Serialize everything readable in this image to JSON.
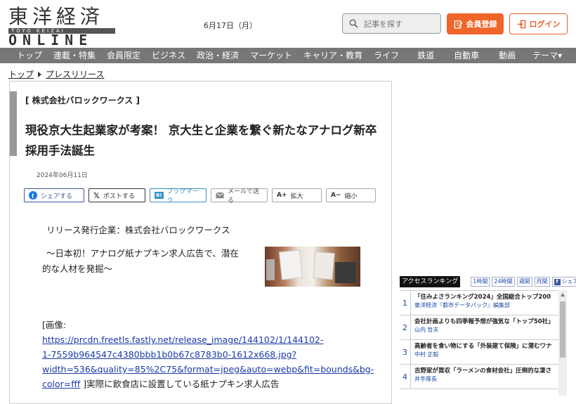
{
  "header": {
    "logo_main": "東洋経済",
    "logo_sub": "TOYO KEIZAI",
    "logo_bottom": "ONLINE",
    "date": "6月17日（月）",
    "search_placeholder": "記事を探す",
    "register_label": "会員登録",
    "login_label": "ログイン"
  },
  "nav": {
    "items": [
      "トップ",
      "連載・特集",
      "会員限定",
      "ビジネス",
      "政治・経済",
      "マーケット",
      "キャリア・教育",
      "ライフ",
      "鉄道",
      "自動車",
      "動画",
      "テーマ▾"
    ]
  },
  "breadcrumb": {
    "top": "トップ",
    "current": "プレスリリース"
  },
  "article": {
    "company_tag": "[ 株式会社バロックワークス ]",
    "headline": "現役京大生起業家が考案！ 京大生と企業を繋ぐ新たなアナログ新卒採用手法誕生",
    "date": "2024年06月11日",
    "share_buttons": {
      "facebook": "シェアする",
      "x": "ポストする",
      "bookmark": "ブックマーク",
      "mail": "メールで送る",
      "zoom_in": "拡大",
      "zoom_out": "縮小"
    },
    "release_company": "リリース発行企業：株式会社バロックワークス",
    "subtitle_line1": "～日本初！アナログ紙ナプキン求人広告で、潜在",
    "subtitle_line2": "的な人材を発掘～",
    "image_label": "[画像:",
    "image_url_lines": [
      "https://prcdn.freetls.fastly.net/release_image/144102/1/144102-",
      "1-7559b964547c4380bbb1b0b67c8783b0-1612x668.jpg?",
      "width=536&quality=85%2C75&format=jpeg&auto=webp&fit=bounds&bg-",
      "color=fff"
    ],
    "image_caption": " ]実際に飲食店に設置している紙ナプキン求人広告"
  },
  "ranking": {
    "title": "アクセスランキング",
    "tabs": [
      "1時間",
      "24時間",
      "週間",
      "月間"
    ],
    "share_label": "シェア",
    "items": [
      {
        "num": "1",
        "headline": "「住みよさランキング2024」全国総合トップ200",
        "source": "東洋経済『都市データパック』編集部"
      },
      {
        "num": "2",
        "headline": "会社計画よりも四季報予想が強気な「トップ50社」",
        "source": "山内 哲夫"
      },
      {
        "num": "3",
        "headline": "高齢者を食い物にする「外装建て保険」に潜むワナ",
        "source": "中村 正毅"
      },
      {
        "num": "4",
        "headline": "吉野家が買収「ラーメンの食材会社」圧倒的な凄さ",
        "source": "井手隊長"
      }
    ]
  },
  "colors": {
    "accent_orange": "#f0662a",
    "nav_gray": "#777777",
    "link_blue": "#1a3aa8"
  }
}
